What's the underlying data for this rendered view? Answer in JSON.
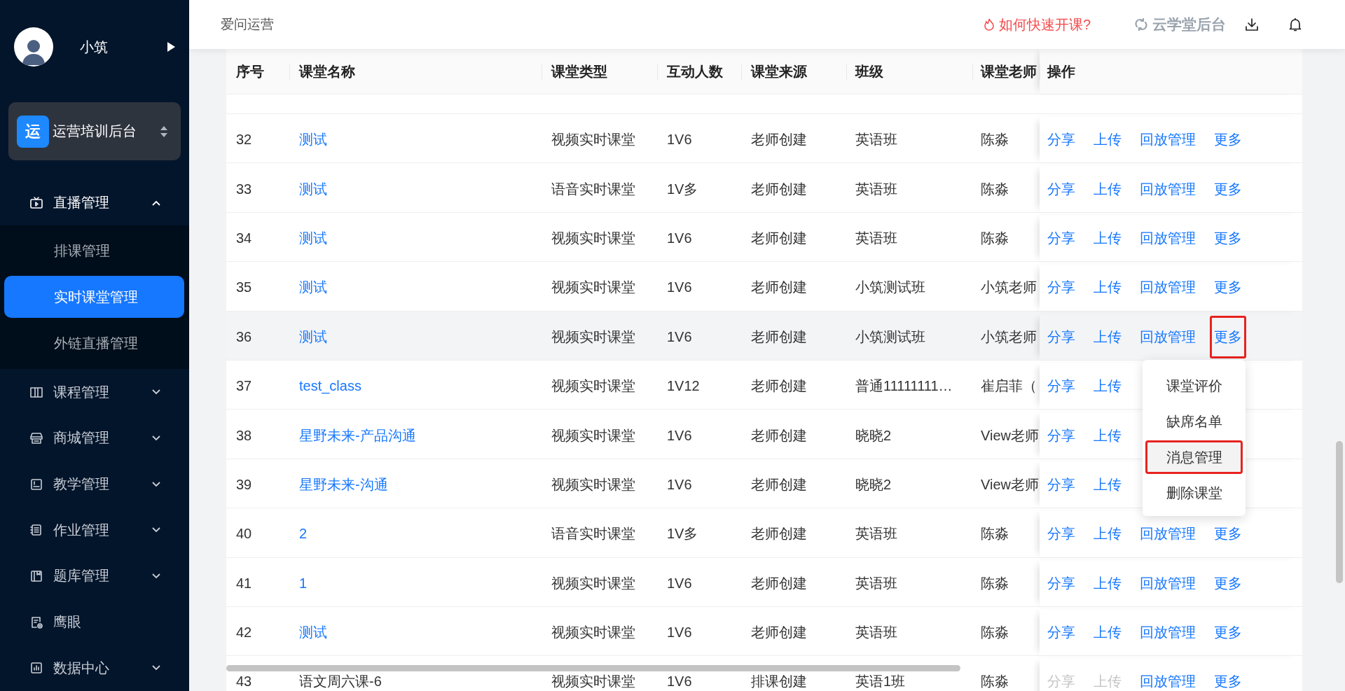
{
  "sidebar": {
    "user": {
      "name": "小筑"
    },
    "org": {
      "badge": "运",
      "name": "运营培训后台"
    },
    "menu": [
      {
        "kind": "group",
        "label": "直播管理",
        "expanded": true,
        "children": [
          {
            "label": "排课管理",
            "selected": false
          },
          {
            "label": "实时课堂管理",
            "selected": true
          },
          {
            "label": "外链直播管理",
            "selected": false
          }
        ]
      },
      {
        "kind": "group",
        "label": "课程管理",
        "expanded": false
      },
      {
        "kind": "group",
        "label": "商城管理",
        "expanded": false
      },
      {
        "kind": "group",
        "label": "教学管理",
        "expanded": false
      },
      {
        "kind": "group",
        "label": "作业管理",
        "expanded": false
      },
      {
        "kind": "group",
        "label": "题库管理",
        "expanded": false
      },
      {
        "kind": "link",
        "label": "鹰眼"
      },
      {
        "kind": "group",
        "label": "数据中心",
        "expanded": false
      }
    ]
  },
  "header": {
    "title": "爱问运营",
    "help_link": "如何快速开课?",
    "brand": "云学堂后台"
  },
  "table": {
    "columns": [
      "序号",
      "课堂名称",
      "课堂类型",
      "互动人数",
      "课堂来源",
      "班级",
      "课堂老师",
      "操作"
    ],
    "rows": [
      {
        "no": "32",
        "name": "测试",
        "link": true,
        "type": "视频实时课堂",
        "count": "1V6",
        "source": "老师创建",
        "class": "英语班",
        "teacher": "陈淼",
        "hovered": false,
        "ops": [
          {
            "label": "分享",
            "disabled": false,
            "highlighted": false
          },
          {
            "label": "上传",
            "disabled": false,
            "highlighted": false
          },
          {
            "label": "回放管理",
            "disabled": false,
            "highlighted": false
          },
          {
            "label": "更多",
            "disabled": false,
            "highlighted": false
          }
        ]
      },
      {
        "no": "33",
        "name": "测试",
        "link": true,
        "type": "语音实时课堂",
        "count": "1V多",
        "source": "老师创建",
        "class": "英语班",
        "teacher": "陈淼",
        "hovered": false,
        "ops": [
          {
            "label": "分享",
            "disabled": false,
            "highlighted": false
          },
          {
            "label": "上传",
            "disabled": false,
            "highlighted": false
          },
          {
            "label": "回放管理",
            "disabled": false,
            "highlighted": false
          },
          {
            "label": "更多",
            "disabled": false,
            "highlighted": false
          }
        ]
      },
      {
        "no": "34",
        "name": "测试",
        "link": true,
        "type": "视频实时课堂",
        "count": "1V6",
        "source": "老师创建",
        "class": "英语班",
        "teacher": "陈淼",
        "hovered": false,
        "ops": [
          {
            "label": "分享",
            "disabled": false,
            "highlighted": false
          },
          {
            "label": "上传",
            "disabled": false,
            "highlighted": false
          },
          {
            "label": "回放管理",
            "disabled": false,
            "highlighted": false
          },
          {
            "label": "更多",
            "disabled": false,
            "highlighted": false
          }
        ]
      },
      {
        "no": "35",
        "name": "测试",
        "link": true,
        "type": "视频实时课堂",
        "count": "1V6",
        "source": "老师创建",
        "class": "小筑测试班",
        "teacher": "小筑老师",
        "hovered": false,
        "ops": [
          {
            "label": "分享",
            "disabled": false,
            "highlighted": false
          },
          {
            "label": "上传",
            "disabled": false,
            "highlighted": false
          },
          {
            "label": "回放管理",
            "disabled": false,
            "highlighted": false
          },
          {
            "label": "更多",
            "disabled": false,
            "highlighted": false
          }
        ]
      },
      {
        "no": "36",
        "name": "测试",
        "link": true,
        "type": "视频实时课堂",
        "count": "1V6",
        "source": "老师创建",
        "class": "小筑测试班",
        "teacher": "小筑老师",
        "hovered": true,
        "ops": [
          {
            "label": "分享",
            "disabled": false,
            "highlighted": false
          },
          {
            "label": "上传",
            "disabled": false,
            "highlighted": false
          },
          {
            "label": "回放管理",
            "disabled": false,
            "highlighted": false
          },
          {
            "label": "更多",
            "disabled": false,
            "highlighted": true
          }
        ]
      },
      {
        "no": "37",
        "name": "test_class",
        "link": true,
        "type": "视频实时课堂",
        "count": "1V12",
        "source": "老师创建",
        "class": "普通11111111…",
        "teacher": "崔启菲（",
        "hovered": false,
        "ops": [
          {
            "label": "分享",
            "disabled": false,
            "highlighted": false
          },
          {
            "label": "上传",
            "disabled": false,
            "highlighted": false
          }
        ]
      },
      {
        "no": "38",
        "name": "星野未来-产品沟通",
        "link": true,
        "type": "视频实时课堂",
        "count": "1V6",
        "source": "老师创建",
        "class": "晓晓2",
        "teacher": "View老师",
        "hovered": false,
        "ops": [
          {
            "label": "分享",
            "disabled": false,
            "highlighted": false
          },
          {
            "label": "上传",
            "disabled": false,
            "highlighted": false
          }
        ]
      },
      {
        "no": "39",
        "name": "星野未来-沟通",
        "link": true,
        "type": "视频实时课堂",
        "count": "1V6",
        "source": "老师创建",
        "class": "晓晓2",
        "teacher": "View老师",
        "hovered": false,
        "ops": [
          {
            "label": "分享",
            "disabled": false,
            "highlighted": false
          },
          {
            "label": "上传",
            "disabled": false,
            "highlighted": false
          }
        ]
      },
      {
        "no": "40",
        "name": "2",
        "link": true,
        "type": "语音实时课堂",
        "count": "1V多",
        "source": "老师创建",
        "class": "英语班",
        "teacher": "陈淼",
        "hovered": false,
        "ops": [
          {
            "label": "分享",
            "disabled": false,
            "highlighted": false
          },
          {
            "label": "上传",
            "disabled": false,
            "highlighted": false
          },
          {
            "label": "回放管理",
            "disabled": false,
            "highlighted": false
          },
          {
            "label": "更多",
            "disabled": false,
            "highlighted": false
          }
        ]
      },
      {
        "no": "41",
        "name": "1",
        "link": true,
        "type": "视频实时课堂",
        "count": "1V6",
        "source": "老师创建",
        "class": "英语班",
        "teacher": "陈淼",
        "hovered": false,
        "ops": [
          {
            "label": "分享",
            "disabled": false,
            "highlighted": false
          },
          {
            "label": "上传",
            "disabled": false,
            "highlighted": false
          },
          {
            "label": "回放管理",
            "disabled": false,
            "highlighted": false
          },
          {
            "label": "更多",
            "disabled": false,
            "highlighted": false
          }
        ]
      },
      {
        "no": "42",
        "name": "测试",
        "link": true,
        "type": "视频实时课堂",
        "count": "1V6",
        "source": "老师创建",
        "class": "英语班",
        "teacher": "陈淼",
        "hovered": false,
        "ops": [
          {
            "label": "分享",
            "disabled": false,
            "highlighted": false
          },
          {
            "label": "上传",
            "disabled": false,
            "highlighted": false
          },
          {
            "label": "回放管理",
            "disabled": false,
            "highlighted": false
          },
          {
            "label": "更多",
            "disabled": false,
            "highlighted": false
          }
        ]
      },
      {
        "no": "43",
        "name": "语文周六课-6",
        "link": false,
        "type": "视频实时课堂",
        "count": "1V6",
        "source": "排课创建",
        "class": "英语1班",
        "teacher": "陈淼",
        "hovered": false,
        "ops": [
          {
            "label": "分享",
            "disabled": true,
            "highlighted": false
          },
          {
            "label": "上传",
            "disabled": true,
            "highlighted": false
          },
          {
            "label": "回放管理",
            "disabled": false,
            "highlighted": false
          },
          {
            "label": "更多",
            "disabled": false,
            "highlighted": false
          }
        ]
      }
    ]
  },
  "dropdown": {
    "items": [
      {
        "label": "课堂评价",
        "highlighted": false
      },
      {
        "label": "缺席名单",
        "highlighted": false
      },
      {
        "label": "消息管理",
        "highlighted": true
      },
      {
        "label": "删除课堂",
        "highlighted": false
      }
    ]
  }
}
